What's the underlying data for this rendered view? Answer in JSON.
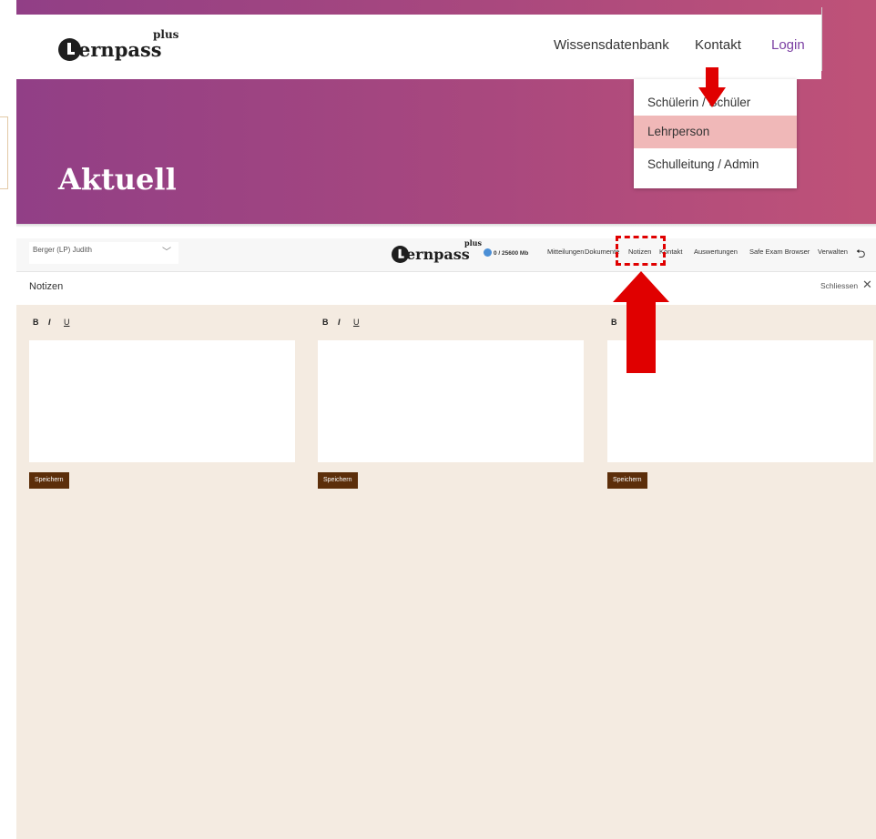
{
  "website": {
    "logo": {
      "main": "ernpass",
      "suffix": "plus"
    },
    "nav": {
      "wissensdatenbank": "Wissensdatenbank",
      "kontakt": "Kontakt",
      "login": "Login"
    },
    "hero_title": "Aktuell",
    "login_menu": [
      "Schülerin / Schüler",
      "Lehrperson",
      "Schulleitung / Admin"
    ],
    "login_menu_highlighted": "Lehrperson"
  },
  "app": {
    "user_select": "Berger (LP) Judith",
    "logo": {
      "main": "ernpass",
      "suffix": "plus"
    },
    "storage": "0 / 25600 Mb",
    "nav": [
      "Mitteilungen",
      "Dokumente",
      "Notizen",
      "Kontakt",
      "Auswertungen",
      "Safe Exam Browser",
      "Verwalten"
    ],
    "panel_title": "Notizen",
    "close_label": "Schliessen",
    "format_bold": "B",
    "format_italic": "I",
    "format_underline": "U",
    "save_label": "Speichern"
  },
  "colors": {
    "hero_gradient_start": "#913f86",
    "hero_gradient_end": "#bf5278",
    "login_link": "#7b3fa3",
    "highlight": "#f0b8b8",
    "notes_background": "#f4ebe1",
    "save_button": "#5c2e0a",
    "annotation_red": "#e00000"
  },
  "icons": {
    "close": "close-icon",
    "chevron": "chevron-down-icon",
    "storage": "storage-icon",
    "logout": "logout-icon"
  }
}
